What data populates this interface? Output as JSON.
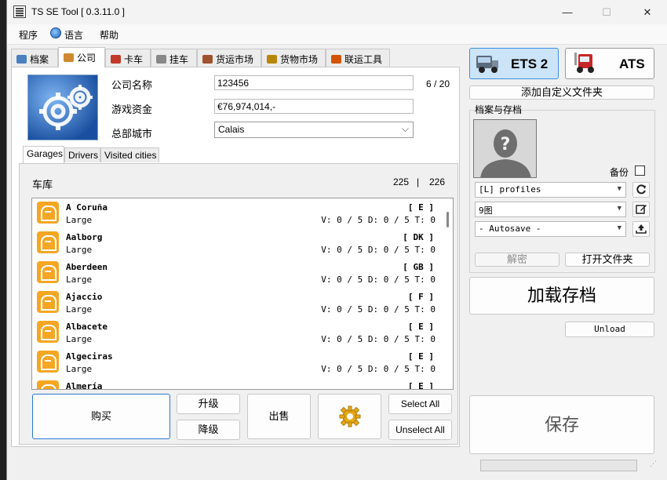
{
  "window": {
    "title": "TS SE Tool [ 0.3.11.0 ]",
    "controls": {
      "minimize": "—",
      "maximize": "☐",
      "close": "✕"
    }
  },
  "menu": {
    "items": [
      "程序",
      "语言",
      "帮助"
    ]
  },
  "tabs": [
    {
      "label": "档案",
      "icon": "profile-icon",
      "color": "#4a7fc0"
    },
    {
      "label": "公司",
      "icon": "company-icon",
      "color": "#d08a2e"
    },
    {
      "label": "卡车",
      "icon": "truck-icon",
      "color": "#c0392b"
    },
    {
      "label": "挂车",
      "icon": "trailer-icon",
      "color": "#888888"
    },
    {
      "label": "货运市场",
      "icon": "freight-market-icon",
      "color": "#a0522d"
    },
    {
      "label": "货物市场",
      "icon": "cargo-market-icon",
      "color": "#b8860b"
    },
    {
      "label": "联运工具",
      "icon": "convoy-tools-icon",
      "color": "#d35400"
    }
  ],
  "company": {
    "name_label": "公司名称",
    "name_value": "123456",
    "name_count": "6 / 20",
    "money_label": "游戏资金",
    "money_value": "€76,974,014,-",
    "hq_label": "总部城市",
    "hq_value": "Calais"
  },
  "subtabs": [
    "Garages",
    "Drivers",
    "Visited cities"
  ],
  "garages": {
    "title": "车库",
    "count_a": "225",
    "separator": "|",
    "count_b": "226",
    "rows": [
      {
        "name": "A Coruña",
        "size": "Large",
        "country": "[ E ]",
        "stats": "V: 0 / 5 D: 0 / 5 T: 0"
      },
      {
        "name": "Aalborg",
        "size": "Large",
        "country": "[ DK ]",
        "stats": "V: 0 / 5 D: 0 / 5 T: 0"
      },
      {
        "name": "Aberdeen",
        "size": "Large",
        "country": "[ GB ]",
        "stats": "V: 0 / 5 D: 0 / 5 T: 0"
      },
      {
        "name": "Ajaccio",
        "size": "Large",
        "country": "[ F ]",
        "stats": "V: 0 / 5 D: 0 / 5 T: 0"
      },
      {
        "name": "Albacete",
        "size": "Large",
        "country": "[ E ]",
        "stats": "V: 0 / 5 D: 0 / 5 T: 0"
      },
      {
        "name": "Algeciras",
        "size": "Large",
        "country": "[ E ]",
        "stats": "V: 0 / 5 D: 0 / 5 T: 0"
      },
      {
        "name": "Almería",
        "size": "",
        "country": "[ E ]",
        "stats": ""
      }
    ],
    "buttons": {
      "buy": "购买",
      "upgrade": "升级",
      "downgrade": "降级",
      "sell": "出售",
      "select_all": "Select All",
      "unselect_all": "Unselect All"
    }
  },
  "right": {
    "game_ets2": "ETS 2",
    "game_ats": "ATS",
    "add_folder": "添加自定义文件夹",
    "profiles_group": "档案与存档",
    "backup_label": "备份",
    "profile_select": "[L] profiles",
    "profile_name": "9图",
    "save_select": "- Autosave -",
    "decrypt": "解密",
    "open_folder": "打开文件夹",
    "load_save": "加载存档",
    "unload": "Unload",
    "save": "保存"
  },
  "progress": {
    "value": 0
  }
}
